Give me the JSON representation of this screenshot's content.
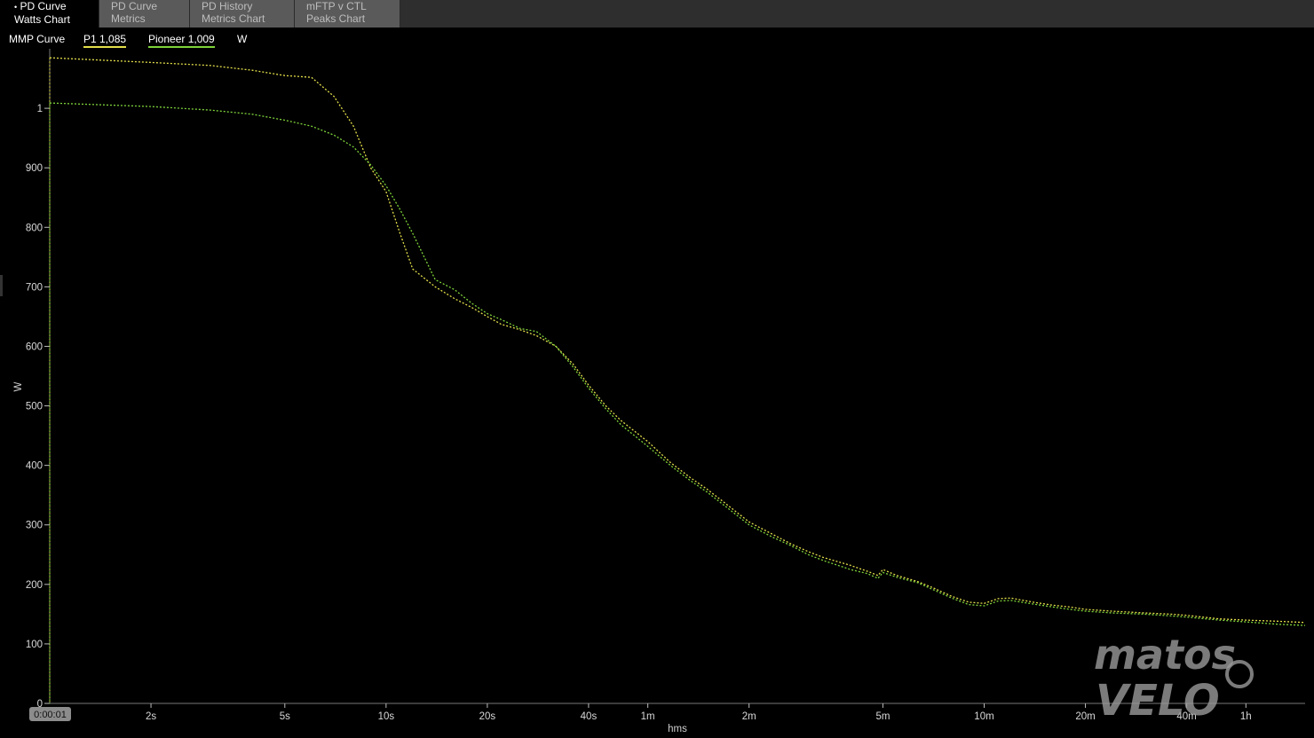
{
  "tabs": [
    {
      "line1": "PD Curve",
      "line2": "Watts Chart",
      "active": true,
      "bullet": "•"
    },
    {
      "line1": "PD Curve",
      "line2": "Metrics",
      "active": false
    },
    {
      "line1": "PD History",
      "line2": "Metrics Chart",
      "active": false
    },
    {
      "line1": "mFTP v CTL",
      "line2": "Peaks Chart",
      "active": false
    }
  ],
  "legend": {
    "title": "MMP Curve",
    "series": [
      {
        "label": "P1  1,085",
        "color": "#e3df4a"
      },
      {
        "label": "Pioneer  1,009",
        "color": "#7ed33a"
      }
    ],
    "unit": "W"
  },
  "selected_time": "0:00:01",
  "watermark": {
    "line1": "matos",
    "line2": "VELO"
  },
  "chart_data": {
    "type": "line",
    "x_scale": "log",
    "xlabel": "hms",
    "ylabel": "W",
    "ylim": [
      0,
      1100
    ],
    "xlim_seconds": [
      1,
      5400
    ],
    "y_ticks": [
      {
        "value": 0,
        "label": "0"
      },
      {
        "value": 100,
        "label": "100"
      },
      {
        "value": 200,
        "label": "200"
      },
      {
        "value": 300,
        "label": "300"
      },
      {
        "value": 400,
        "label": "400"
      },
      {
        "value": 500,
        "label": "500"
      },
      {
        "value": 600,
        "label": "600"
      },
      {
        "value": 700,
        "label": "700"
      },
      {
        "value": 800,
        "label": "800"
      },
      {
        "value": 900,
        "label": "900"
      },
      {
        "value": 1000,
        "label": "1"
      }
    ],
    "x_ticks": [
      {
        "seconds": 2,
        "label": "2s"
      },
      {
        "seconds": 5,
        "label": "5s"
      },
      {
        "seconds": 10,
        "label": "10s"
      },
      {
        "seconds": 20,
        "label": "20s"
      },
      {
        "seconds": 40,
        "label": "40s"
      },
      {
        "seconds": 60,
        "label": "1m"
      },
      {
        "seconds": 120,
        "label": "2m"
      },
      {
        "seconds": 300,
        "label": "5m"
      },
      {
        "seconds": 600,
        "label": "10m"
      },
      {
        "seconds": 1200,
        "label": "20m"
      },
      {
        "seconds": 2400,
        "label": "40m"
      },
      {
        "seconds": 3600,
        "label": "1h"
      }
    ],
    "series": [
      {
        "name": "P1",
        "color": "#e3df4a",
        "points": [
          [
            1,
            1085
          ],
          [
            2,
            1077
          ],
          [
            3,
            1072
          ],
          [
            4,
            1064
          ],
          [
            5,
            1055
          ],
          [
            6,
            1052
          ],
          [
            7,
            1020
          ],
          [
            8,
            970
          ],
          [
            9,
            900
          ],
          [
            10,
            860
          ],
          [
            11,
            790
          ],
          [
            12,
            730
          ],
          [
            14,
            700
          ],
          [
            16,
            680
          ],
          [
            18,
            665
          ],
          [
            20,
            650
          ],
          [
            22,
            637
          ],
          [
            25,
            628
          ],
          [
            28,
            618
          ],
          [
            32,
            600
          ],
          [
            36,
            570
          ],
          [
            40,
            535
          ],
          [
            45,
            500
          ],
          [
            50,
            475
          ],
          [
            60,
            440
          ],
          [
            70,
            405
          ],
          [
            80,
            380
          ],
          [
            90,
            360
          ],
          [
            100,
            340
          ],
          [
            120,
            305
          ],
          [
            140,
            285
          ],
          [
            160,
            268
          ],
          [
            180,
            255
          ],
          [
            200,
            245
          ],
          [
            240,
            232
          ],
          [
            270,
            222
          ],
          [
            290,
            215
          ],
          [
            300,
            225
          ],
          [
            330,
            215
          ],
          [
            380,
            205
          ],
          [
            420,
            195
          ],
          [
            480,
            180
          ],
          [
            540,
            170
          ],
          [
            600,
            168
          ],
          [
            660,
            176
          ],
          [
            720,
            177
          ],
          [
            840,
            170
          ],
          [
            960,
            165
          ],
          [
            1080,
            162
          ],
          [
            1200,
            158
          ],
          [
            1440,
            155
          ],
          [
            1800,
            152
          ],
          [
            2160,
            150
          ],
          [
            2400,
            148
          ],
          [
            3000,
            142
          ],
          [
            3600,
            140
          ],
          [
            4500,
            138
          ],
          [
            5400,
            136
          ]
        ]
      },
      {
        "name": "Pioneer",
        "color": "#7ed33a",
        "points": [
          [
            1,
            1009
          ],
          [
            2,
            1003
          ],
          [
            3,
            997
          ],
          [
            4,
            990
          ],
          [
            5,
            980
          ],
          [
            6,
            970
          ],
          [
            7,
            955
          ],
          [
            8,
            935
          ],
          [
            9,
            905
          ],
          [
            10,
            870
          ],
          [
            11,
            830
          ],
          [
            12,
            790
          ],
          [
            14,
            712
          ],
          [
            16,
            695
          ],
          [
            18,
            672
          ],
          [
            20,
            655
          ],
          [
            22,
            645
          ],
          [
            25,
            630
          ],
          [
            28,
            625
          ],
          [
            32,
            600
          ],
          [
            36,
            565
          ],
          [
            40,
            530
          ],
          [
            45,
            495
          ],
          [
            50,
            468
          ],
          [
            60,
            432
          ],
          [
            70,
            400
          ],
          [
            80,
            375
          ],
          [
            90,
            355
          ],
          [
            100,
            335
          ],
          [
            120,
            300
          ],
          [
            140,
            280
          ],
          [
            160,
            265
          ],
          [
            180,
            250
          ],
          [
            200,
            240
          ],
          [
            240,
            225
          ],
          [
            270,
            218
          ],
          [
            290,
            210
          ],
          [
            300,
            220
          ],
          [
            330,
            212
          ],
          [
            380,
            203
          ],
          [
            420,
            192
          ],
          [
            480,
            177
          ],
          [
            540,
            166
          ],
          [
            600,
            164
          ],
          [
            660,
            172
          ],
          [
            720,
            173
          ],
          [
            840,
            167
          ],
          [
            960,
            162
          ],
          [
            1080,
            158
          ],
          [
            1200,
            155
          ],
          [
            1440,
            152
          ],
          [
            1800,
            150
          ],
          [
            2160,
            147
          ],
          [
            2400,
            145
          ],
          [
            3000,
            140
          ],
          [
            3600,
            137
          ],
          [
            4500,
            133
          ],
          [
            5400,
            131
          ]
        ]
      }
    ]
  }
}
